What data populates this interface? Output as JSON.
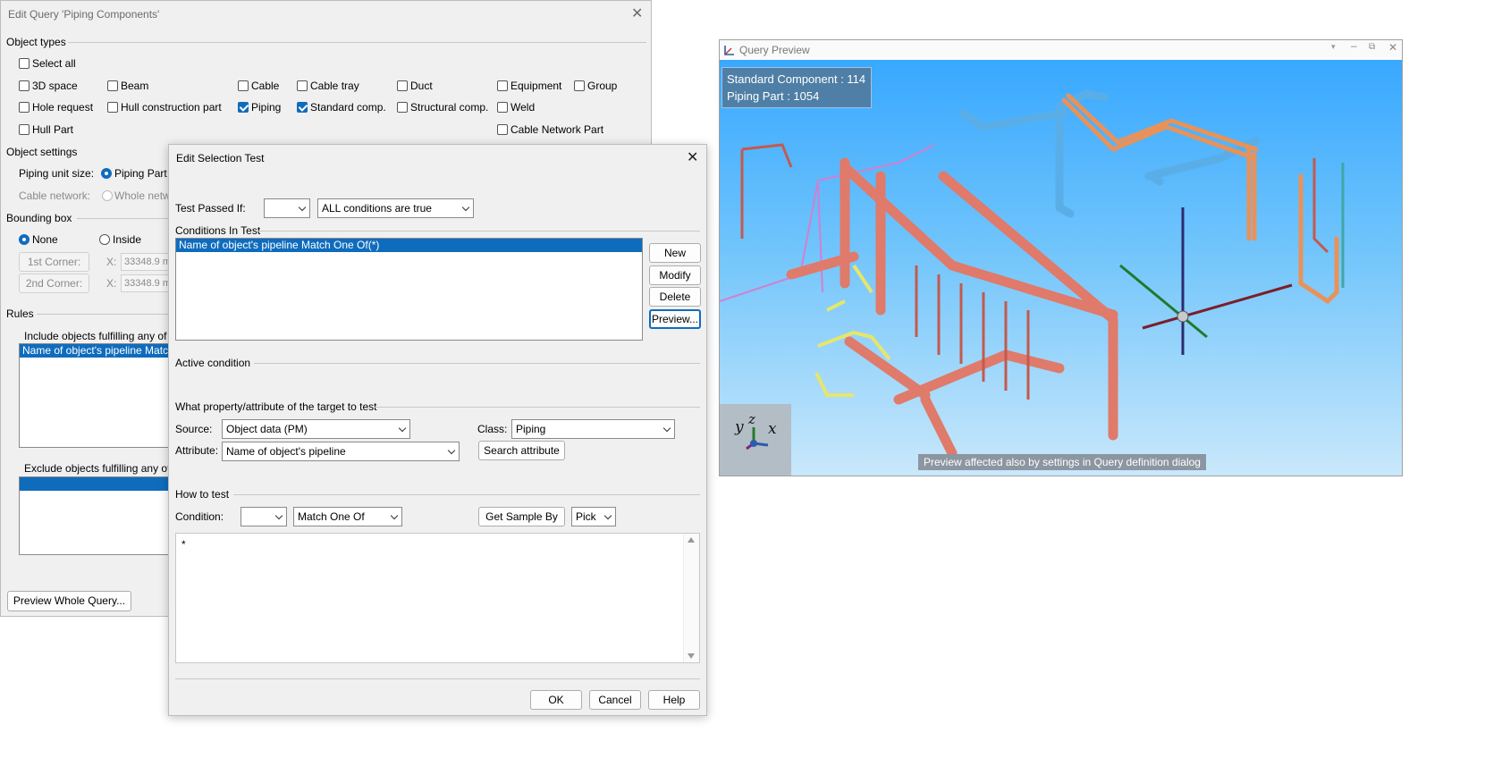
{
  "query_dialog": {
    "title": "Edit Query 'Piping Components'",
    "object_types_heading": "Object types",
    "checkboxes": [
      {
        "label": "Select all",
        "checked": false
      },
      {
        "label": "3D space",
        "checked": false
      },
      {
        "label": "Beam",
        "checked": false
      },
      {
        "label": "Cable",
        "checked": false
      },
      {
        "label": "Cable tray",
        "checked": false
      },
      {
        "label": "Duct",
        "checked": false
      },
      {
        "label": "Equipment",
        "checked": false
      },
      {
        "label": "Group",
        "checked": false
      },
      {
        "label": "Hole request",
        "checked": false
      },
      {
        "label": "Hull construction part",
        "checked": false
      },
      {
        "label": "Piping",
        "checked": true
      },
      {
        "label": "Standard comp.",
        "checked": true
      },
      {
        "label": "Structural comp.",
        "checked": false
      },
      {
        "label": "Weld",
        "checked": false
      },
      {
        "label": "Hull Part",
        "checked": false
      },
      {
        "label": "Cable Network Part",
        "checked": false
      }
    ],
    "object_settings_heading": "Object settings",
    "piping_unit_size_label": "Piping unit size:",
    "piping_part_option": "Piping Part",
    "cable_network_label": "Cable network:",
    "whole_network_option": "Whole netw",
    "bounding_box_heading": "Bounding box",
    "none_option": "None",
    "inside_option": "Inside",
    "corner1_button": "1st Corner:",
    "corner2_button": "2nd Corner:",
    "x_label": "X:",
    "corner1_x": "33348.9 mi",
    "corner2_x": "33348.9 mi",
    "rules_heading": "Rules",
    "include_label": "Include objects fulfilling any of th",
    "include_item": "Name of object's pipeline Match",
    "exclude_label": "Exclude objects fulfilling any of th",
    "preview_whole_button": "Preview Whole Query..."
  },
  "selection_dialog": {
    "title": "Edit Selection Test",
    "test_passed_label": "Test Passed If:",
    "test_passed_prefix": "",
    "test_passed_value": "ALL conditions are true",
    "conditions_heading": "Conditions In Test",
    "conditions": [
      "Name of object's pipeline Match One Of(*)"
    ],
    "new_button": "New",
    "modify_button": "Modify",
    "delete_button": "Delete",
    "preview_button": "Preview...",
    "active_condition_heading": "Active condition",
    "property_heading": "What property/attribute of the target to test",
    "source_label": "Source:",
    "source_value": "Object data (PM)",
    "class_label": "Class:",
    "class_value": "Piping",
    "attribute_label": "Attribute:",
    "attribute_value": "Name of object's pipeline",
    "search_attribute_button": "Search attribute",
    "how_to_test_heading": "How to test",
    "condition_label": "Condition:",
    "condition_prefix": "",
    "condition_value": "Match One Of",
    "get_sample_button": "Get Sample By",
    "pick_value": "Pick",
    "values_text": "*",
    "ok_button": "OK",
    "cancel_button": "Cancel",
    "help_button": "Help"
  },
  "preview_window": {
    "title": "Query Preview",
    "stat_standard": "Standard Component : 114",
    "stat_piping": "Piping Part : 1054",
    "note": "Preview affected also by settings in Query definition dialog",
    "axis_y": "y",
    "axis_z": "z",
    "axis_x": "x",
    "colors": {
      "pipe_red": "#e07a6a",
      "pipe_blue": "#5aaee8",
      "pipe_orange": "#e8925a",
      "pipe_yellow": "#e6e66a",
      "sky_top": "#38a8ff",
      "sky_bottom": "#c9e8fb"
    }
  }
}
